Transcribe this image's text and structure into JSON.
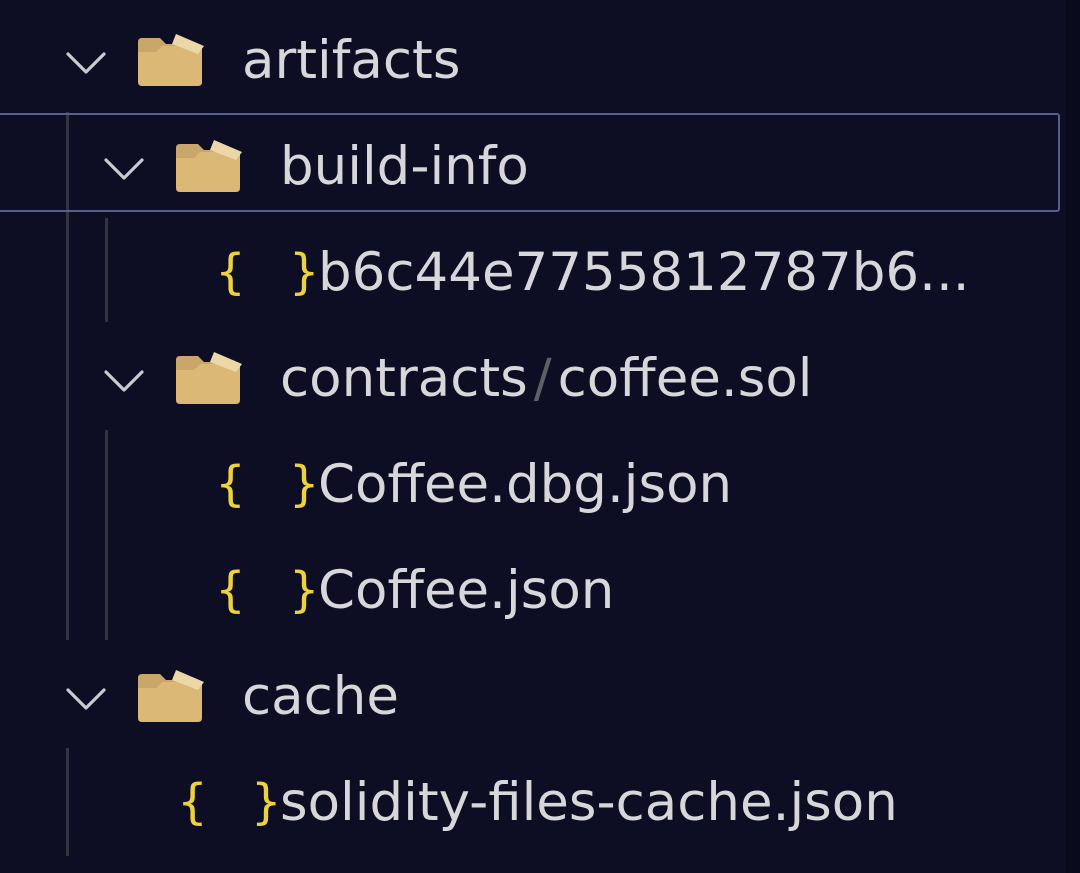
{
  "tree": {
    "artifacts": {
      "label": "artifacts",
      "build_info": {
        "label": "build-info",
        "file": "b6c44e7755812787b6..."
      },
      "contracts": {
        "parent_label": "contracts",
        "separator": "/",
        "child_label": "coffee.sol",
        "files": [
          "Coffee.dbg.json",
          "Coffee.json"
        ]
      }
    },
    "cache": {
      "label": "cache",
      "file": "solidity-files-cache.json"
    },
    "json_icon_glyph": "{ }"
  },
  "colors": {
    "background": "#0d0d24",
    "text": "#d7d7da",
    "folder": "#dcb877",
    "json_icon": "#ecd23c",
    "selection_border": "#56608a",
    "indent_guide": "#34343f"
  },
  "icons": {
    "expanded": "chevron-down-icon",
    "folder": "folder-open-icon",
    "json": "json-file-icon"
  }
}
